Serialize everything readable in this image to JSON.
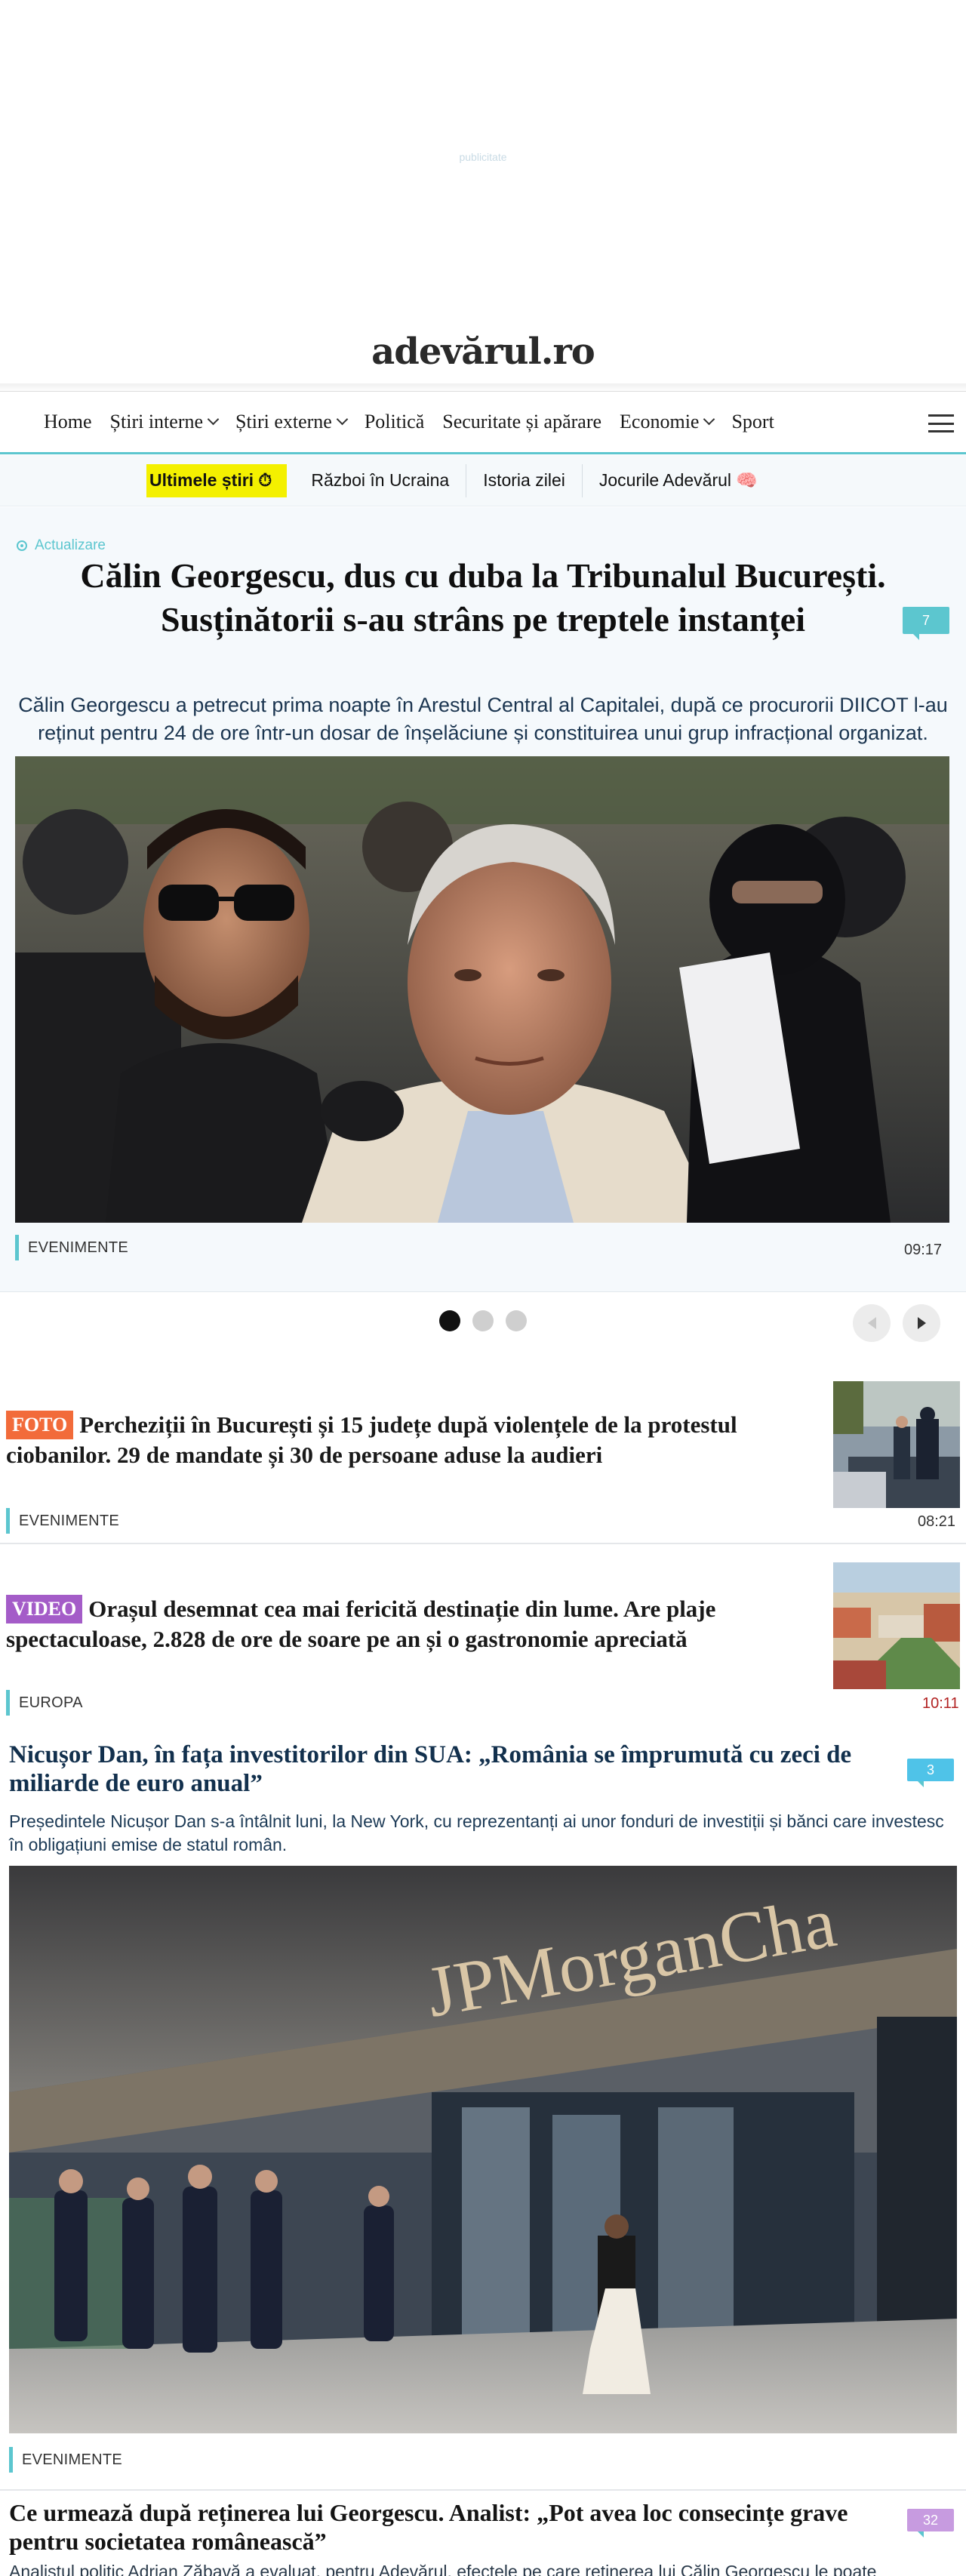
{
  "ad": {
    "label": "publicitate"
  },
  "site": {
    "logo": "adevărul.ro"
  },
  "nav": {
    "items": [
      {
        "label": "Home",
        "dropdown": false
      },
      {
        "label": "Știri interne",
        "dropdown": true
      },
      {
        "label": "Știri externe",
        "dropdown": true
      },
      {
        "label": "Politică",
        "dropdown": false
      },
      {
        "label": "Securitate și apărare",
        "dropdown": false
      },
      {
        "label": "Economie",
        "dropdown": true
      },
      {
        "label": "Sport",
        "dropdown": false
      }
    ]
  },
  "subnav": {
    "highlight": "Ultimele știri ⏱",
    "items": [
      "Război în Ucraina",
      "Istoria zilei",
      "Jocurile Adevărul 🧠"
    ]
  },
  "hero": {
    "update_label": "Actualizare",
    "title": "Călin Georgescu, dus cu duba la Tribunalul București. Susținătorii s-au strâns pe treptele instanței",
    "comments": "7",
    "lead": "Călin Georgescu a petrecut prima noapte în Arestul Central al Capitalei, după ce procurorii DIICOT l-au reținut pentru 24 de ore într-un dosar de înșelăciune și constituirea unui grup infracțional organizat.",
    "category": "EVENIMENTE",
    "time": "09:17"
  },
  "articles": [
    {
      "tag": "FOTO",
      "title": "Percheziții în București și 15 județe după violențele de la protestul ciobanilor. 29 de mandate și 30 de persoane aduse la audieri",
      "category": "EVENIMENTE",
      "time": "08:21"
    },
    {
      "tag": "VIDEO",
      "title": "Orașul desemnat cea mai fericită destinație din lume. Are plaje spectaculoase, 2.828 de ore de soare pe an și o gastronomie apreciată",
      "category": "EUROPA",
      "time": "10:11"
    }
  ],
  "feature": {
    "title": "Nicușor Dan, în fața investitorilor din SUA: „România se împrumută cu zeci de miliarde de euro anual”",
    "comments": "3",
    "lead": "Președintele Nicușor Dan s-a întâlnit luni, la New York, cu reprezentanți ai unor fonduri de investiții și bănci care investesc în obligațiuni emise de statul român.",
    "image_sign": "JPMorganCha",
    "category": "EVENIMENTE"
  },
  "next": {
    "title": "Ce urmează după reținerea lui Georgescu. Analist: „Pot avea loc consecințe grave pentru societatea românească”",
    "comments": "32",
    "lead": "Analistul politic Adrian Zăbavă a evaluat, pentru Adevărul, efectele pe care reținerea lui Călin Georgescu le poate"
  },
  "colors": {
    "accent": "#5cc6cf",
    "foto_tag": "#f26b3a",
    "video_tag": "#a45cc8",
    "highlight": "#f4f000",
    "time_red": "#b22222",
    "comments_purple": "#c79be0",
    "comments_blue": "#4fc3e8"
  }
}
